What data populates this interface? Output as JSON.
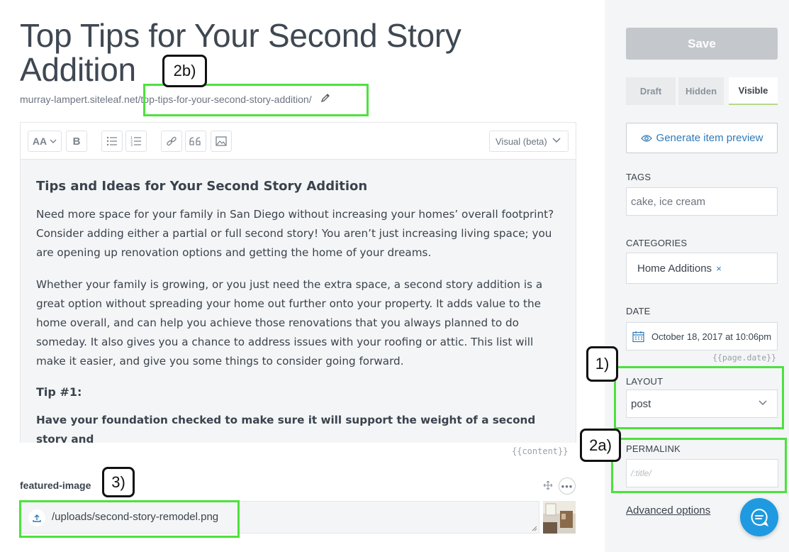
{
  "post": {
    "title": "Top Tips for Your Second Story Addition",
    "url_domain": "murray-lampert.siteleaf.net",
    "url_slug": "/top-tips-for-your-second-story-addition/"
  },
  "editor": {
    "toolbar": {
      "font_size_label": "AA",
      "bold_label": "B",
      "mode_select": "Visual (beta)"
    },
    "content": {
      "heading": "Tips and Ideas for Your Second Story Addition",
      "paragraph_1": "Need more space for your family in San Diego without increasing your homes’ overall footprint? Consider adding either a partial or full second story! You aren’t just increasing living space; you are opening up renovation options and getting the home of your dreams.",
      "paragraph_2": "Whether your family is growing, or you just need the extra space, a second story addition is a great option without spreading your home out further onto your property. It adds value to the home overall, and can help you achieve those renovations that you always planned to do someday. It also gives you a chance to address issues with your roofing or attic. This list will make it easier, and give you some things to consider going forward.",
      "tip_heading": "Tip #1:",
      "tip_text": "Have your foundation checked to make sure it will support the weight of a second story and"
    },
    "variable_tag": "{{content}}"
  },
  "featured_image": {
    "label": "featured-image",
    "path": "/uploads/second-story-remodel.png"
  },
  "sidebar": {
    "save_label": "Save",
    "visibility": [
      "Draft",
      "Hidden",
      "Visible"
    ],
    "visibility_selected": "Visible",
    "preview_label": "Generate item preview",
    "tags_label": "TAGS",
    "tags_value": "cake, ice cream",
    "categories_label": "CATEGORIES",
    "category_chip": "Home Additions",
    "chip_remove": "×",
    "date_label": "DATE",
    "date_value": "October 18, 2017 at 10:06pm",
    "date_tag": "{{page.date}}",
    "layout_label": "LAYOUT",
    "layout_value": "post",
    "permalink_label": "PERMALINK",
    "permalink_placeholder": "/:title/",
    "advanced_label": "Advanced options"
  },
  "annotations": {
    "callout_1": "1)",
    "callout_2a": "2a)",
    "callout_2b": "2b)",
    "callout_3": "3)"
  },
  "colors": {
    "accent_blue": "#2f7ab8",
    "chat_blue": "#1f9ae0",
    "highlight_green": "#4de13e",
    "save_disabled": "#c4c7cb"
  }
}
